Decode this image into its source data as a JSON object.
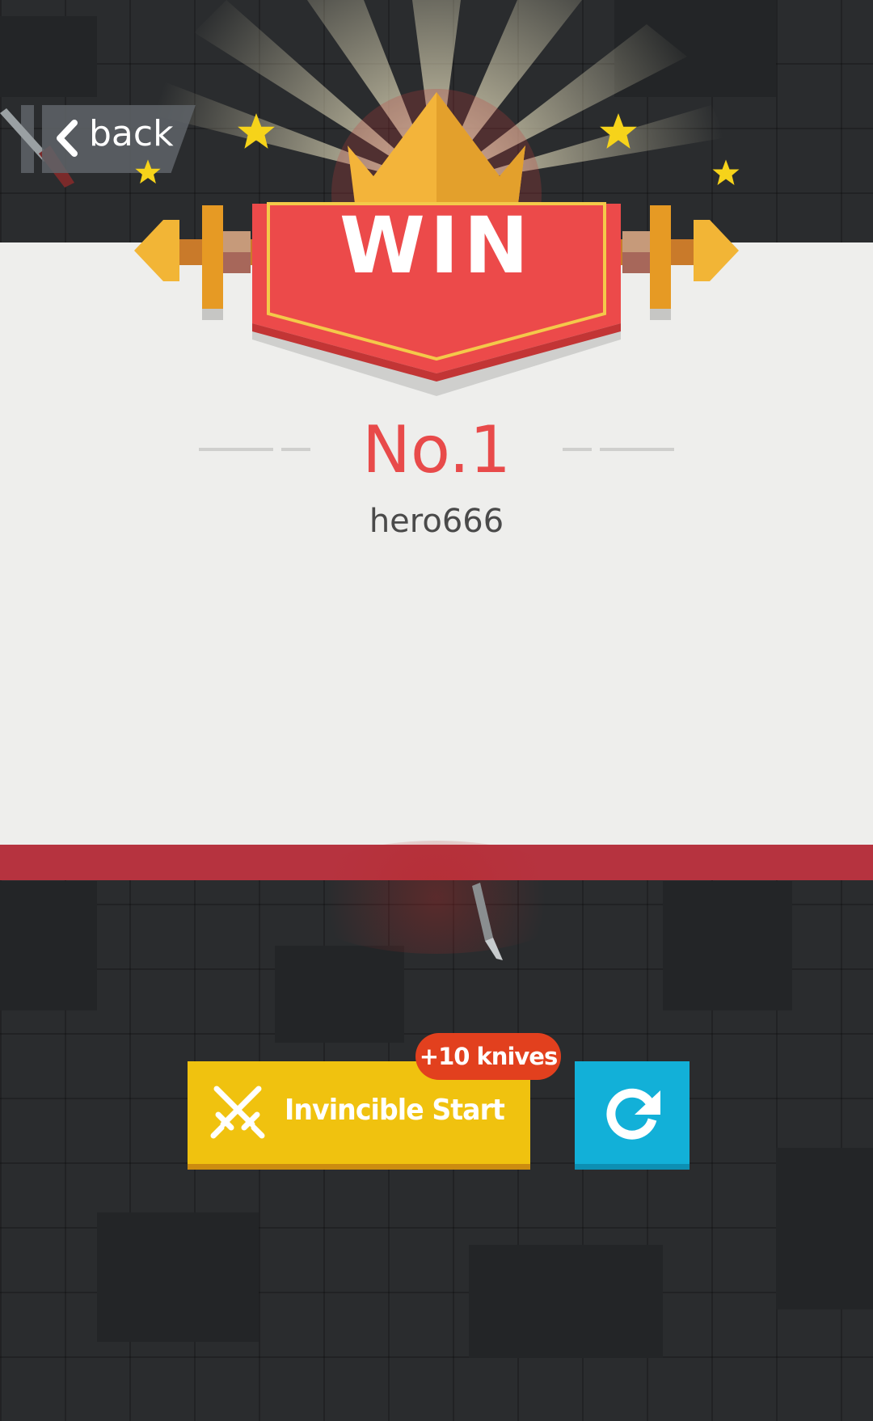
{
  "header": {
    "back_label": "back"
  },
  "result": {
    "banner_text": "WIN",
    "rank": "No.1",
    "player_name": "hero666"
  },
  "actions": {
    "invincible_label": "Invincible Start",
    "bonus_badge": "+10 knives"
  },
  "colors": {
    "background": "#2a2c2e",
    "panel": "#eeeeec",
    "banner_red": "#ec4a4a",
    "crown_gold": "#f3b43a",
    "rank_red": "#e84a4a",
    "invincible_yellow": "#f0c20f",
    "restart_blue": "#12b0d8",
    "bonus_orange": "#e2401e",
    "panel_band": "#b6333f"
  },
  "icons": {
    "back": "chevron-left-icon",
    "invincible": "crossed-swords-icon",
    "restart": "restart-arrow-icon",
    "decor": "star-icon"
  }
}
